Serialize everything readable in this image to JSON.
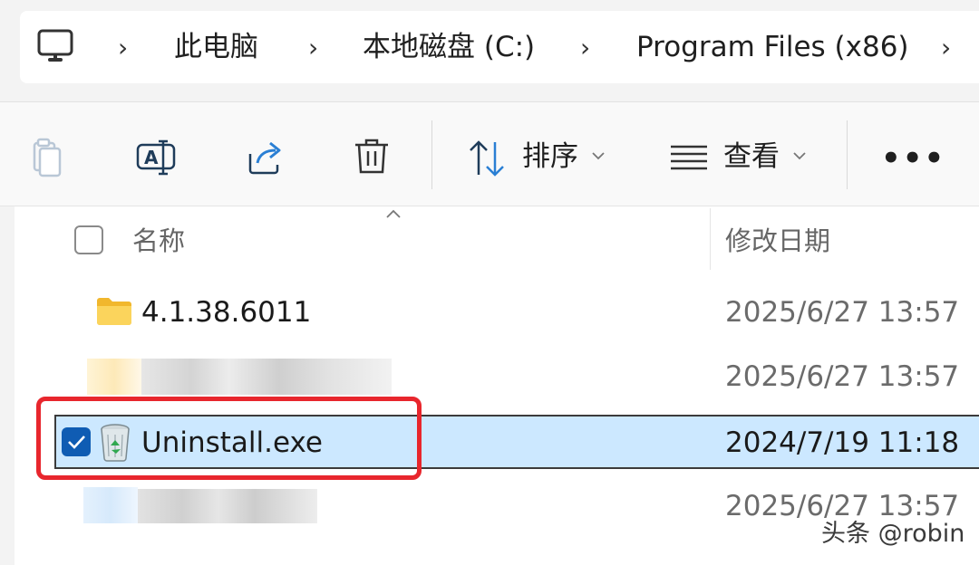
{
  "breadcrumb": {
    "items": [
      "此电脑",
      "本地磁盘 (C:)",
      "Program Files (x86)"
    ],
    "separator": "›"
  },
  "toolbar": {
    "sort_label": "排序",
    "view_label": "查看",
    "more_label": "•••"
  },
  "columns": {
    "name": "名称",
    "modified": "修改日期"
  },
  "files": [
    {
      "name": "4.1.38.6011",
      "date": "2025/6/27 13:57",
      "icon": "folder-icon",
      "selected": false
    },
    {
      "name": "",
      "date": "2025/6/27 13:57",
      "icon": "blurred-icon",
      "selected": false
    },
    {
      "name": "Uninstall.exe",
      "date": "2024/7/19 11:18",
      "icon": "recycle-bin-icon",
      "selected": true
    },
    {
      "name": "",
      "date": "2025/6/27 13:57",
      "icon": "blurred-icon",
      "selected": false
    }
  ],
  "watermark": "头条 @robin",
  "colors": {
    "selection": "#cce8ff",
    "accent": "#0f5cb3",
    "highlight": "#e8262d",
    "folder": "#f8c434"
  }
}
